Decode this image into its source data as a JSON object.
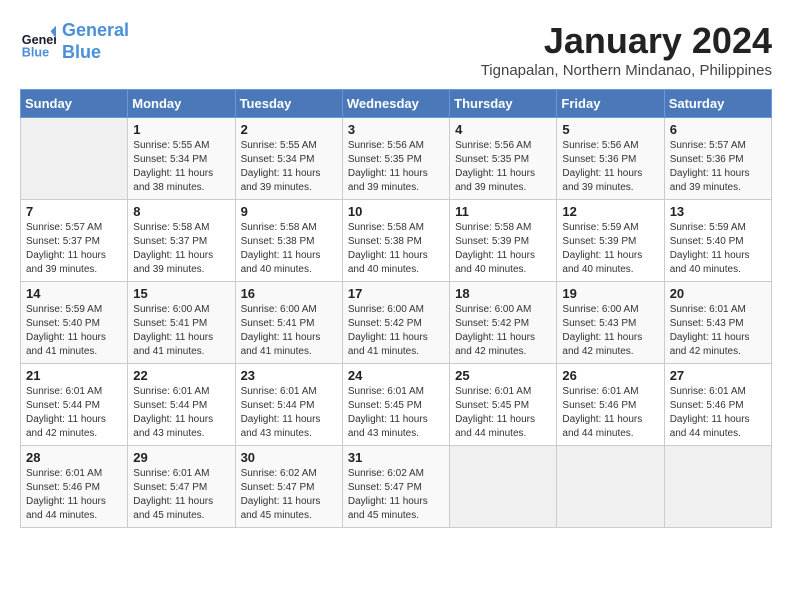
{
  "header": {
    "logo_line1": "General",
    "logo_line2": "Blue",
    "month": "January 2024",
    "location": "Tignapalan, Northern Mindanao, Philippines"
  },
  "weekdays": [
    "Sunday",
    "Monday",
    "Tuesday",
    "Wednesday",
    "Thursday",
    "Friday",
    "Saturday"
  ],
  "weeks": [
    [
      {
        "day": "",
        "sunrise": "",
        "sunset": "",
        "daylight": ""
      },
      {
        "day": "1",
        "sunrise": "5:55 AM",
        "sunset": "5:34 PM",
        "daylight": "11 hours and 38 minutes."
      },
      {
        "day": "2",
        "sunrise": "5:55 AM",
        "sunset": "5:34 PM",
        "daylight": "11 hours and 39 minutes."
      },
      {
        "day": "3",
        "sunrise": "5:56 AM",
        "sunset": "5:35 PM",
        "daylight": "11 hours and 39 minutes."
      },
      {
        "day": "4",
        "sunrise": "5:56 AM",
        "sunset": "5:35 PM",
        "daylight": "11 hours and 39 minutes."
      },
      {
        "day": "5",
        "sunrise": "5:56 AM",
        "sunset": "5:36 PM",
        "daylight": "11 hours and 39 minutes."
      },
      {
        "day": "6",
        "sunrise": "5:57 AM",
        "sunset": "5:36 PM",
        "daylight": "11 hours and 39 minutes."
      }
    ],
    [
      {
        "day": "7",
        "sunrise": "5:57 AM",
        "sunset": "5:37 PM",
        "daylight": "11 hours and 39 minutes."
      },
      {
        "day": "8",
        "sunrise": "5:58 AM",
        "sunset": "5:37 PM",
        "daylight": "11 hours and 39 minutes."
      },
      {
        "day": "9",
        "sunrise": "5:58 AM",
        "sunset": "5:38 PM",
        "daylight": "11 hours and 40 minutes."
      },
      {
        "day": "10",
        "sunrise": "5:58 AM",
        "sunset": "5:38 PM",
        "daylight": "11 hours and 40 minutes."
      },
      {
        "day": "11",
        "sunrise": "5:58 AM",
        "sunset": "5:39 PM",
        "daylight": "11 hours and 40 minutes."
      },
      {
        "day": "12",
        "sunrise": "5:59 AM",
        "sunset": "5:39 PM",
        "daylight": "11 hours and 40 minutes."
      },
      {
        "day": "13",
        "sunrise": "5:59 AM",
        "sunset": "5:40 PM",
        "daylight": "11 hours and 40 minutes."
      }
    ],
    [
      {
        "day": "14",
        "sunrise": "5:59 AM",
        "sunset": "5:40 PM",
        "daylight": "11 hours and 41 minutes."
      },
      {
        "day": "15",
        "sunrise": "6:00 AM",
        "sunset": "5:41 PM",
        "daylight": "11 hours and 41 minutes."
      },
      {
        "day": "16",
        "sunrise": "6:00 AM",
        "sunset": "5:41 PM",
        "daylight": "11 hours and 41 minutes."
      },
      {
        "day": "17",
        "sunrise": "6:00 AM",
        "sunset": "5:42 PM",
        "daylight": "11 hours and 41 minutes."
      },
      {
        "day": "18",
        "sunrise": "6:00 AM",
        "sunset": "5:42 PM",
        "daylight": "11 hours and 42 minutes."
      },
      {
        "day": "19",
        "sunrise": "6:00 AM",
        "sunset": "5:43 PM",
        "daylight": "11 hours and 42 minutes."
      },
      {
        "day": "20",
        "sunrise": "6:01 AM",
        "sunset": "5:43 PM",
        "daylight": "11 hours and 42 minutes."
      }
    ],
    [
      {
        "day": "21",
        "sunrise": "6:01 AM",
        "sunset": "5:44 PM",
        "daylight": "11 hours and 42 minutes."
      },
      {
        "day": "22",
        "sunrise": "6:01 AM",
        "sunset": "5:44 PM",
        "daylight": "11 hours and 43 minutes."
      },
      {
        "day": "23",
        "sunrise": "6:01 AM",
        "sunset": "5:44 PM",
        "daylight": "11 hours and 43 minutes."
      },
      {
        "day": "24",
        "sunrise": "6:01 AM",
        "sunset": "5:45 PM",
        "daylight": "11 hours and 43 minutes."
      },
      {
        "day": "25",
        "sunrise": "6:01 AM",
        "sunset": "5:45 PM",
        "daylight": "11 hours and 44 minutes."
      },
      {
        "day": "26",
        "sunrise": "6:01 AM",
        "sunset": "5:46 PM",
        "daylight": "11 hours and 44 minutes."
      },
      {
        "day": "27",
        "sunrise": "6:01 AM",
        "sunset": "5:46 PM",
        "daylight": "11 hours and 44 minutes."
      }
    ],
    [
      {
        "day": "28",
        "sunrise": "6:01 AM",
        "sunset": "5:46 PM",
        "daylight": "11 hours and 44 minutes."
      },
      {
        "day": "29",
        "sunrise": "6:01 AM",
        "sunset": "5:47 PM",
        "daylight": "11 hours and 45 minutes."
      },
      {
        "day": "30",
        "sunrise": "6:02 AM",
        "sunset": "5:47 PM",
        "daylight": "11 hours and 45 minutes."
      },
      {
        "day": "31",
        "sunrise": "6:02 AM",
        "sunset": "5:47 PM",
        "daylight": "11 hours and 45 minutes."
      },
      {
        "day": "",
        "sunrise": "",
        "sunset": "",
        "daylight": ""
      },
      {
        "day": "",
        "sunrise": "",
        "sunset": "",
        "daylight": ""
      },
      {
        "day": "",
        "sunrise": "",
        "sunset": "",
        "daylight": ""
      }
    ]
  ]
}
